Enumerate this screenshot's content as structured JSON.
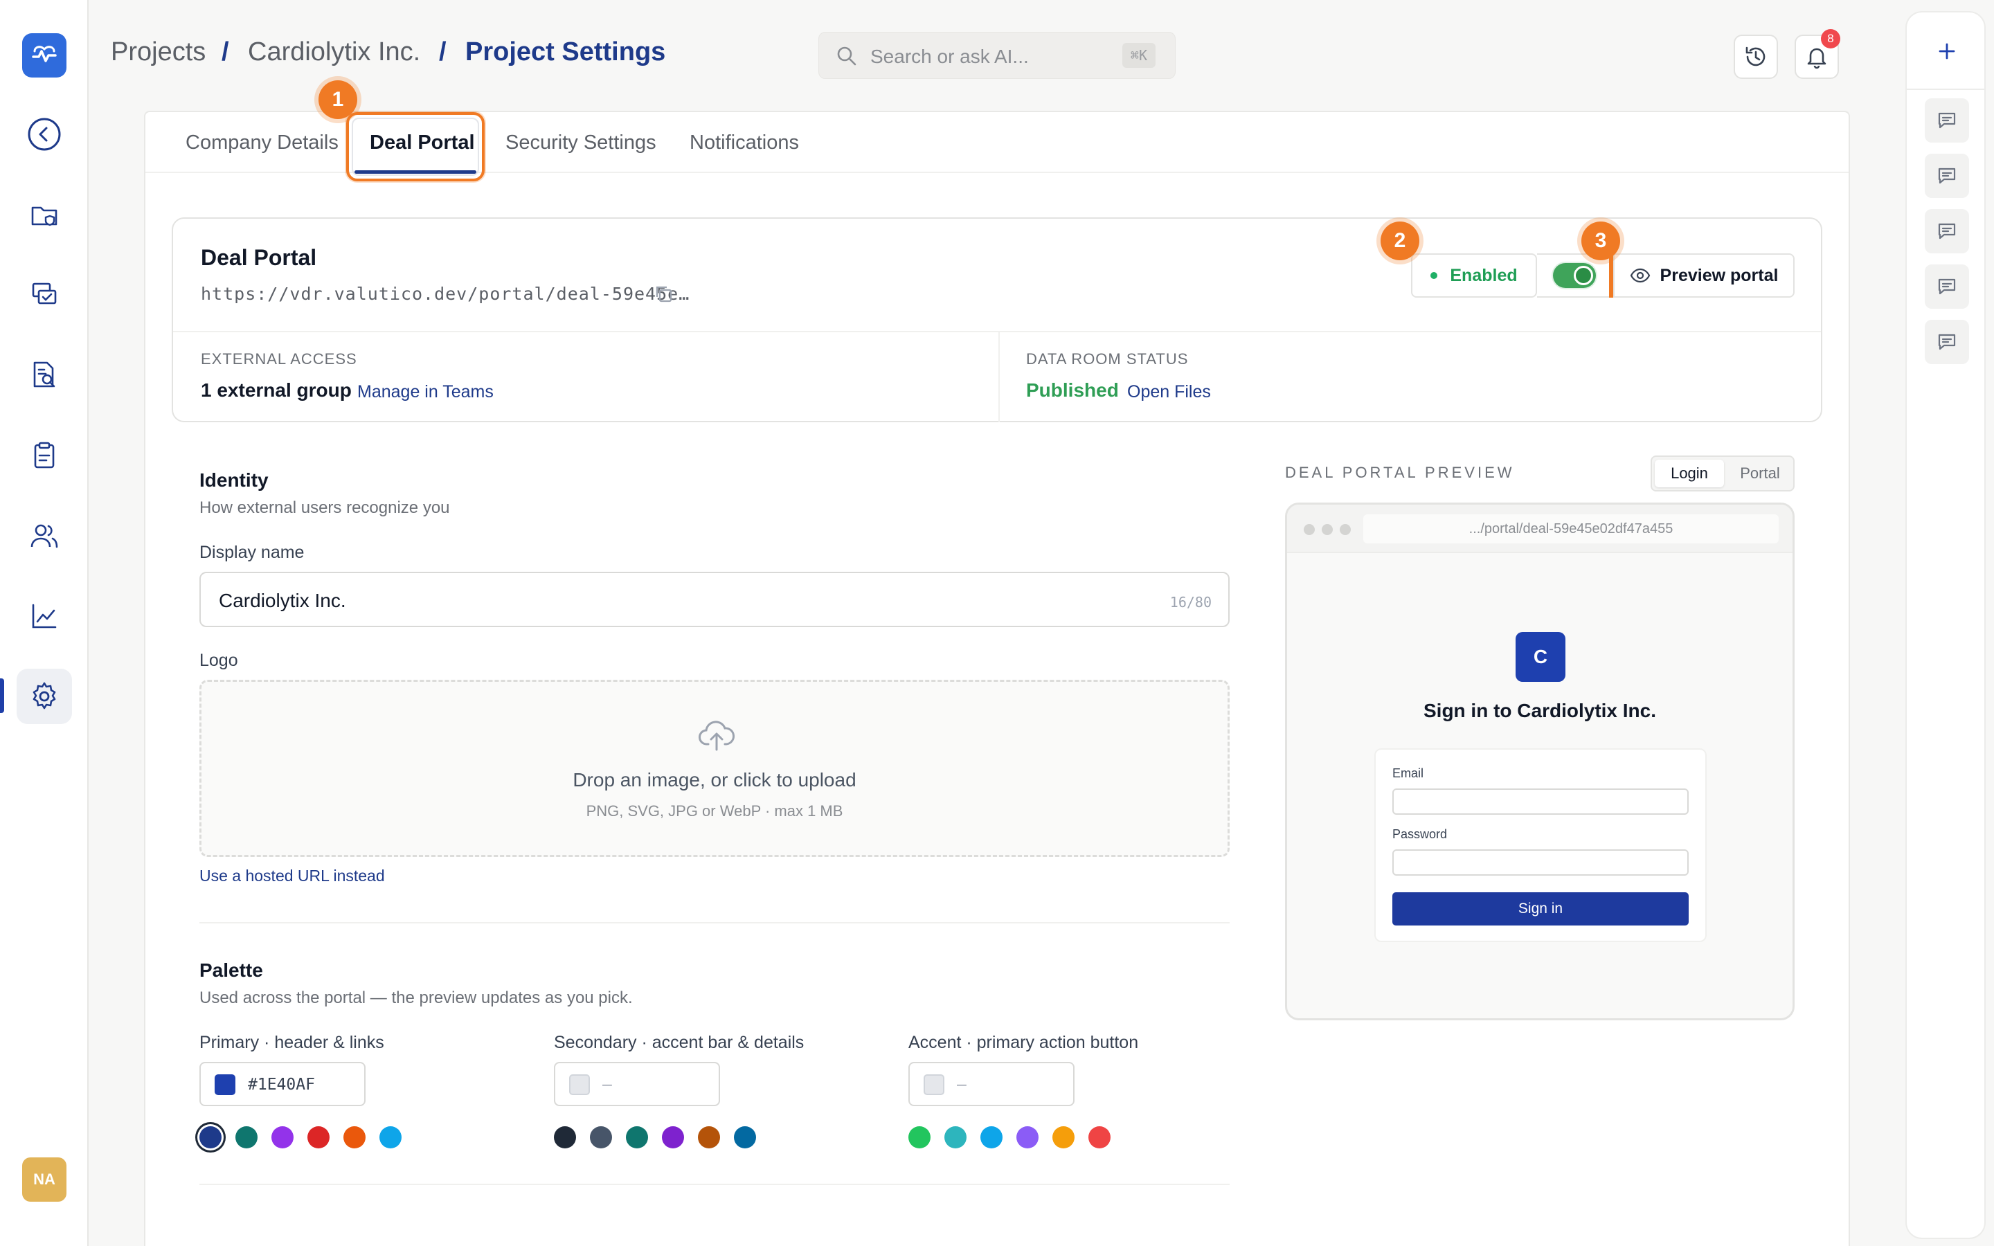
{
  "app": {
    "logo_icon": "heartbeat-icon",
    "user_initials": "NA"
  },
  "sidebar": {
    "items": [
      {
        "name": "back",
        "icon": "chevron-left-icon"
      },
      {
        "name": "documents",
        "icon": "folder-shield-icon"
      },
      {
        "name": "review",
        "icon": "chat-check-icon"
      },
      {
        "name": "search-docs",
        "icon": "document-search-icon"
      },
      {
        "name": "tasks",
        "icon": "clipboard-icon"
      },
      {
        "name": "users",
        "icon": "users-icon"
      },
      {
        "name": "analytics",
        "icon": "chart-line-icon"
      },
      {
        "name": "settings",
        "icon": "gear-icon",
        "active": true
      }
    ]
  },
  "breadcrumb": {
    "items": [
      "Projects",
      "Cardiolytix Inc.",
      "Project Settings"
    ],
    "separator": "/"
  },
  "search": {
    "placeholder": "Search or ask AI...",
    "shortcut": "⌘K"
  },
  "header": {
    "notifications_count": "8"
  },
  "tabs": [
    {
      "label": "Company Details"
    },
    {
      "label": "Deal Portal",
      "active": true
    },
    {
      "label": "Security Settings"
    },
    {
      "label": "Notifications"
    }
  ],
  "steps": [
    "1",
    "2",
    "3"
  ],
  "portal": {
    "title": "Deal Portal",
    "url": "https://vdr.valutico.dev/portal/deal-59e45e…",
    "status_label": "Enabled",
    "enabled": true,
    "preview_label": "Preview portal",
    "external_access": {
      "label": "EXTERNAL ACCESS",
      "value": "1 external group",
      "link": "Manage in Teams"
    },
    "data_room": {
      "label": "DATA ROOM STATUS",
      "value": "Published",
      "link": "Open Files"
    }
  },
  "identity": {
    "title": "Identity",
    "subtitle": "How external users recognize you",
    "display_name_label": "Display name",
    "display_name_value": "Cardiolytix Inc.",
    "display_name_count": "16/80",
    "logo_label": "Logo",
    "upload_text": "Drop an image, or click to upload",
    "upload_hint": "PNG, SVG, JPG or WebP · max 1 MB",
    "hosted_url_link": "Use a hosted URL instead"
  },
  "palette": {
    "title": "Palette",
    "subtitle": "Used across the portal — the preview updates as you pick.",
    "groups": [
      {
        "label": "Primary · header & links",
        "value": "#1E40AF",
        "swatch": "#1E40AF",
        "options": [
          "#1E3A8A",
          "#0F766E",
          "#9333EA",
          "#DC2626",
          "#EA580C",
          "#0EA5E9"
        ],
        "selected": 0
      },
      {
        "label": "Secondary · accent bar & details",
        "value": "—",
        "swatch": "#E5E7EB",
        "options": [
          "#1F2937",
          "#475569",
          "#0F766E",
          "#7E22CE",
          "#B45309",
          "#0369A1"
        ],
        "selected": -1
      },
      {
        "label": "Accent · primary action button",
        "value": "—",
        "swatch": "#E5E7EB",
        "options": [
          "#22C55E",
          "#2DB5BD",
          "#0EA5E9",
          "#8B5CF6",
          "#F59E0B",
          "#EF4444"
        ],
        "selected": -1
      }
    ]
  },
  "preview": {
    "label": "DEAL PORTAL PREVIEW",
    "mode_login": "Login",
    "mode_portal": "Portal",
    "url": ".../portal/deal-59e45e02df47a455",
    "logo_letter": "C",
    "heading": "Sign in to Cardiolytix Inc.",
    "email_label": "Email",
    "password_label": "Password",
    "button": "Sign in"
  },
  "colors": {
    "accent": "#1E3A8A",
    "highlight": "#F07A24",
    "success": "#2F9E55"
  }
}
